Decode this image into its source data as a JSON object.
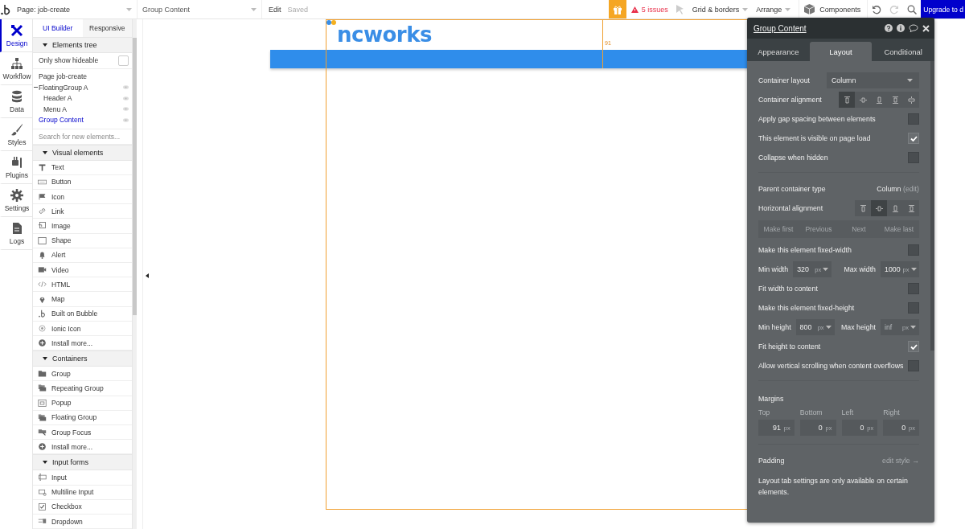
{
  "top_bar": {
    "page_selector": "Page: job-create",
    "element_selector": "Group Content",
    "edit": "Edit",
    "saved": "Saved",
    "issues": "5 issues",
    "menus": [
      "Grid & borders",
      "Arrange"
    ],
    "components": "Components",
    "upgrade": "Upgrade to d"
  },
  "rail": [
    {
      "label": "Design",
      "selected": true
    },
    {
      "label": "Workflow",
      "selected": false
    },
    {
      "label": "Data",
      "selected": false
    },
    {
      "label": "Styles",
      "selected": false
    },
    {
      "label": "Plugins",
      "selected": false
    },
    {
      "label": "Settings",
      "selected": false
    },
    {
      "label": "Logs",
      "selected": false
    }
  ],
  "sidebar": {
    "tabs": [
      {
        "label": "UI Builder",
        "selected": true
      },
      {
        "label": "Responsive",
        "selected": false
      }
    ],
    "tree_title": "Elements tree",
    "only_hideable": {
      "label": "Only show hideable",
      "checked": false
    },
    "tree": [
      {
        "label": "Page job-create",
        "selected": false,
        "hideable": false,
        "expanded": false
      },
      {
        "label": "FloatingGroup A",
        "selected": false,
        "hideable": true,
        "expanded": true,
        "children": [
          {
            "label": "Header A",
            "selected": false,
            "hideable": true,
            "expanded": false
          },
          {
            "label": "Menu A",
            "selected": false,
            "hideable": true,
            "expanded": false
          }
        ]
      },
      {
        "label": "Group Content",
        "selected": true,
        "hideable": true,
        "expanded": false
      }
    ],
    "search": {
      "placeholder": "Search for new elements..."
    },
    "sections": [
      {
        "title": "Visual elements",
        "items": [
          "Text",
          "Button",
          "Icon",
          "Link",
          "Image",
          "Shape",
          "Alert",
          "Video",
          "HTML",
          "Map",
          "Built on Bubble",
          "Ionic Icon",
          "Install more..."
        ]
      },
      {
        "title": "Containers",
        "items": [
          "Group",
          "Repeating Group",
          "Popup",
          "Floating Group",
          "Group Focus",
          "Install more..."
        ]
      },
      {
        "title": "Input forms",
        "items": [
          "Input",
          "Multiline Input",
          "Checkbox",
          "Dropdown"
        ]
      }
    ]
  },
  "canvas": {
    "logo_text": "ncworks",
    "guide_label": "91"
  },
  "panel": {
    "title": "Group Content",
    "tabs": [
      {
        "label": "Appearance",
        "selected": false
      },
      {
        "label": "Layout",
        "selected": true
      },
      {
        "label": "Conditional",
        "selected": false
      }
    ],
    "sections": [
      [
        {
          "kind": "select",
          "label": "Container layout",
          "value": "Column"
        },
        {
          "kind": "icons",
          "label": "Container alignment",
          "options": [
            {
              "selected": true
            },
            {
              "selected": false
            },
            {
              "selected": false
            },
            {
              "selected": false
            },
            {
              "selected": false
            }
          ]
        },
        {
          "kind": "check",
          "label": "Apply gap spacing between elements",
          "checked": false
        },
        {
          "kind": "check",
          "label": "This element is visible on page load",
          "checked": true
        },
        {
          "kind": "check",
          "label": "Collapse when hidden",
          "checked": false
        }
      ],
      [
        {
          "kind": "info",
          "label": "Parent container type",
          "value": "Column",
          "link": "(edit)"
        },
        {
          "kind": "icons",
          "label": "Horizontal alignment",
          "options": [
            {
              "selected": false
            },
            {
              "selected": true
            },
            {
              "selected": false
            },
            {
              "selected": false
            }
          ]
        },
        {
          "kind": "buttons",
          "buttons": [
            {
              "label": "Make first",
              "disabled": true
            },
            {
              "label": "Previous",
              "disabled": true
            },
            {
              "label": "Next",
              "disabled": true
            },
            {
              "label": "Make last",
              "disabled": true
            }
          ]
        },
        {
          "kind": "check",
          "label": "Make this element fixed-width",
          "checked": false
        },
        {
          "kind": "sizes",
          "fields": [
            {
              "label": "Min width",
              "value": "320",
              "unit": "px"
            },
            {
              "label": "Max width",
              "value": "1000",
              "unit": "px"
            }
          ]
        },
        {
          "kind": "check",
          "label": "Fit width to content",
          "checked": false
        },
        {
          "kind": "check",
          "label": "Make this element fixed-height",
          "checked": false
        },
        {
          "kind": "sizes",
          "fields": [
            {
              "label": "Min height",
              "value": "800",
              "unit": "px"
            },
            {
              "label": "Max height",
              "placeholder": "inf",
              "unit": "px"
            }
          ]
        },
        {
          "kind": "check",
          "label": "Fit height to content",
          "checked": true
        },
        {
          "kind": "check",
          "label": "Allow vertical scrolling when content overflows",
          "checked": false
        }
      ],
      [
        {
          "kind": "margins",
          "label": "Margins",
          "fields": [
            {
              "label": "Top",
              "value": "91",
              "unit": "px"
            },
            {
              "label": "Bottom",
              "value": "0",
              "unit": "px"
            },
            {
              "label": "Left",
              "value": "0",
              "unit": "px"
            },
            {
              "label": "Right",
              "value": "0",
              "unit": "px"
            }
          ]
        }
      ],
      [
        {
          "kind": "link",
          "label": "Padding",
          "link": "edit style →"
        },
        {
          "kind": "note",
          "text": "Layout tab settings are only available on certain elements."
        }
      ]
    ]
  }
}
